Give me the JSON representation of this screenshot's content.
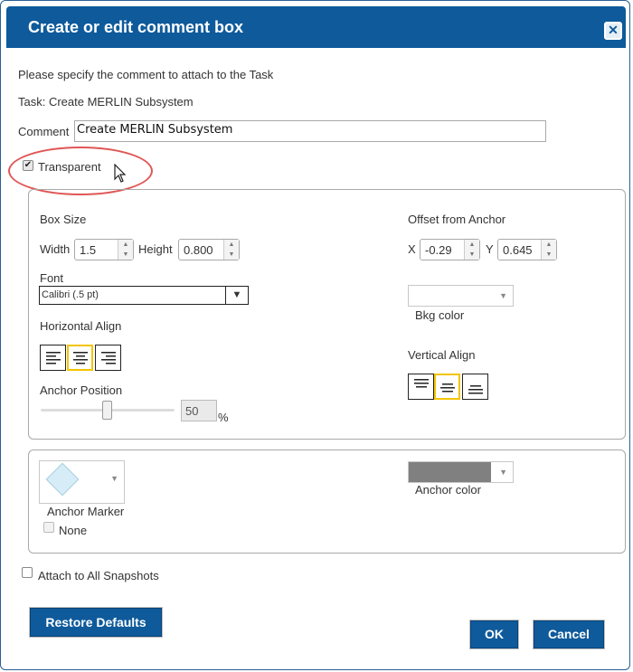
{
  "dialog": {
    "title": "Create or edit comment box",
    "close_glyph": "✕",
    "instruction": "Please specify the comment to attach to the Task",
    "task_line": "Task: Create MERLIN Subsystem",
    "comment_label": "Comment",
    "comment_value": "Create MERLIN Subsystem",
    "transparent": {
      "label": "Transparent",
      "checked": true,
      "check_glyph": "✔"
    }
  },
  "layout_panel": {
    "box_size_label": "Box Size",
    "width_label": "Width",
    "width_value": "1.5",
    "height_label": "Height",
    "height_value": "0.800",
    "font_label": "Font",
    "font_value": "Calibri (.5 pt)",
    "font_caret": "▼",
    "horizontal_align_label": "Horizontal Align",
    "horizontal_align_selected": "center",
    "anchor_position_label": "Anchor Position",
    "anchor_position_value": "50",
    "anchor_position_unit": "%",
    "offset_label": "Offset from Anchor",
    "x_label": "X",
    "x_value": "-0.29",
    "y_label": "Y",
    "y_value": "0.645",
    "bkg_color_label": "Bkg color",
    "bkg_color": "#ffffff",
    "vertical_align_label": "Vertical Align",
    "vertical_align_selected": "middle"
  },
  "anchor_panel": {
    "marker_label": "Anchor Marker",
    "marker_icon": "diamond",
    "none_label": "None",
    "none_checked": false,
    "anchor_color_label": "Anchor color",
    "anchor_color": "#808080"
  },
  "footer": {
    "attach_all_label": "Attach to All Snapshots",
    "attach_all_checked": false,
    "restore_defaults_label": "Restore Defaults",
    "ok_label": "OK",
    "cancel_label": "Cancel"
  },
  "colors": {
    "title_bar": "#0e5a9b",
    "button_primary": "#0e5a9b",
    "selected_align_border": "#f2c500",
    "highlight_ring": "#e05656"
  }
}
